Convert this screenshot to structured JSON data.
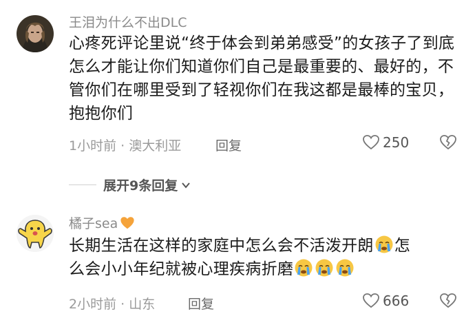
{
  "comments": [
    {
      "username": "王泪为什么不出DLC",
      "text": "心疼死评论里说“终于体会到弟弟感受”的女孩子了到底怎么才能让你们知道你们自己是最重要的、最好的，不管你们在哪里受到了轻视你们在我这都是最棒的宝贝，抱抱你们",
      "time_location": "1小时前 · 澳大利亚",
      "reply_label": "回复",
      "likes": "250"
    },
    {
      "username": "橘子sea",
      "username_badge": "orange-heart-icon",
      "text_line1": "长期生活在这样的家庭中怎么会不活泼开朗",
      "text_line1_end": "怎",
      "text_line2": "么会小小年纪就被心理疾病折磨",
      "time_location": "2小时前 · 山东",
      "reply_label": "回复",
      "likes": "666"
    }
  ],
  "expand": {
    "label": "展开9条回复"
  },
  "colors": {
    "meta": "#9a9a9a",
    "username": "#8a8a8a",
    "heart_badge": "#f5a33a",
    "emoji_face": "#f7c744",
    "tear": "#4aa3f0"
  }
}
